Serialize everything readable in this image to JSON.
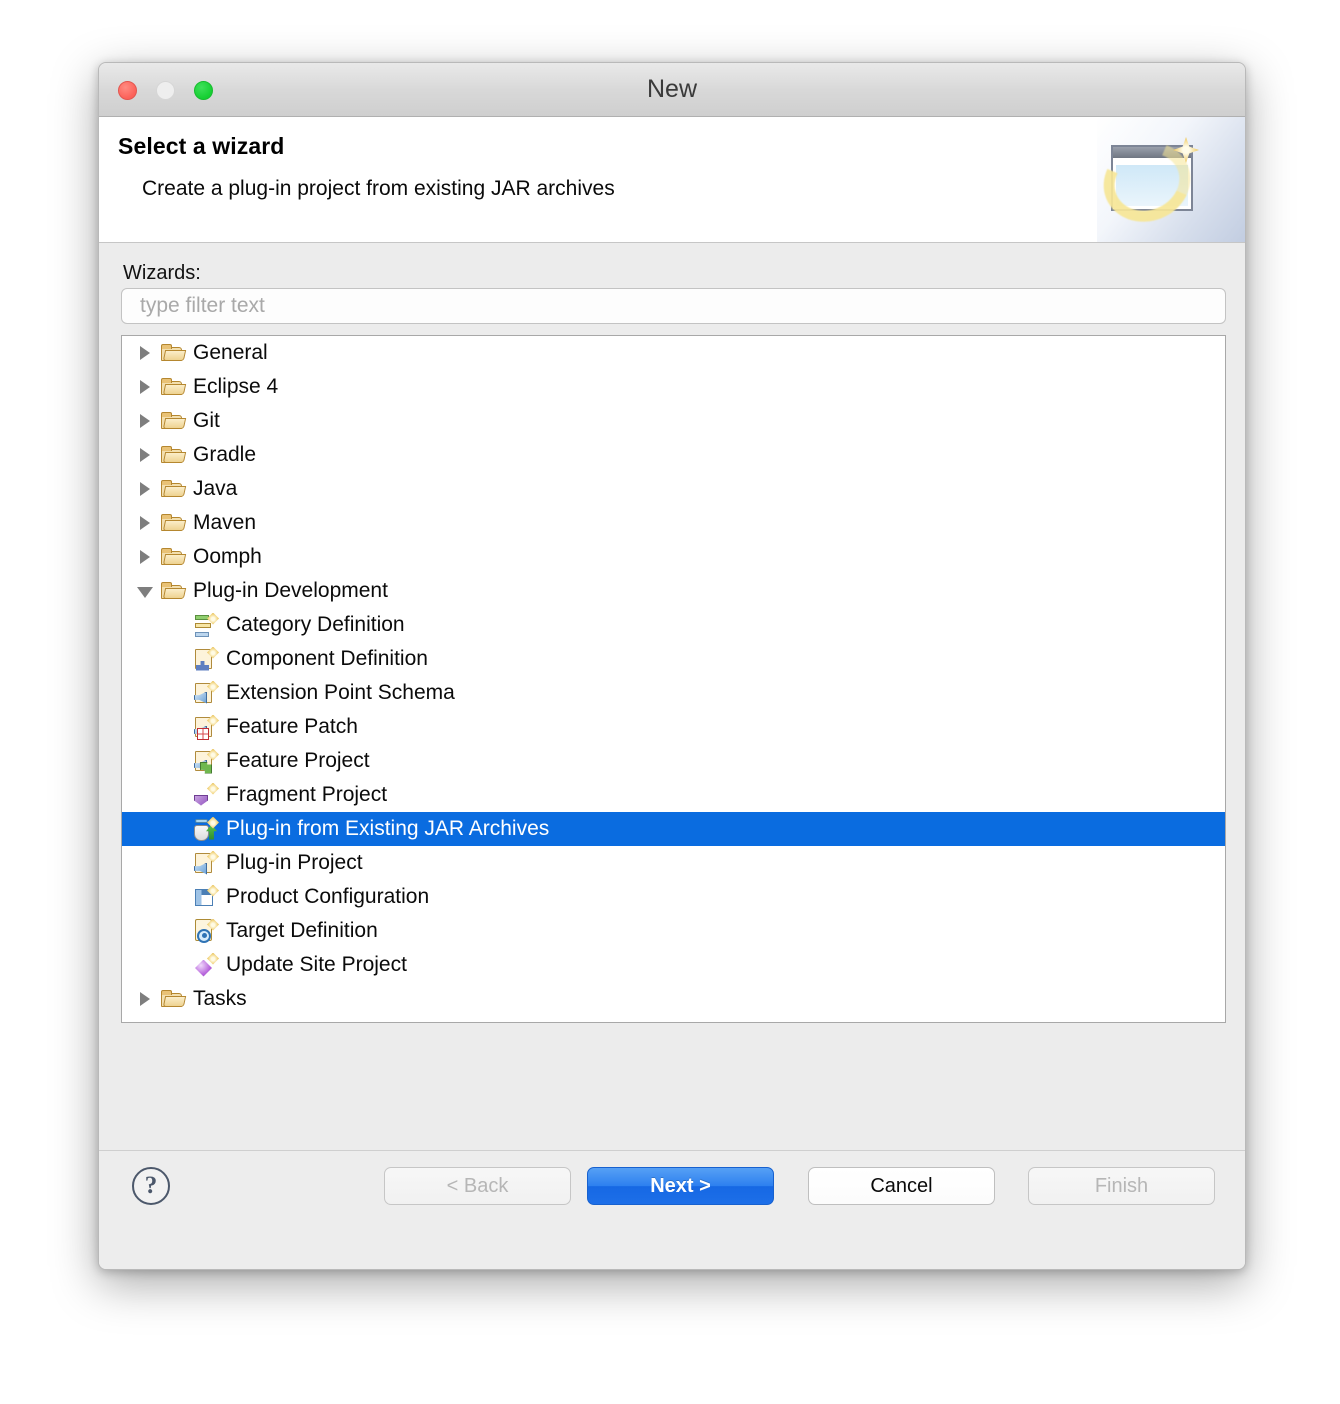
{
  "window": {
    "title": "New",
    "traffic_lights": {
      "close": "close-button",
      "minimize": "minimize-button",
      "maximize": "maximize-button"
    }
  },
  "banner": {
    "title": "Select a wizard",
    "description": "Create a plug-in project from existing JAR archives",
    "artwork": "wizard-banner-icon"
  },
  "main": {
    "wizards_label": "Wizards:",
    "filter": {
      "placeholder": "type filter text",
      "value": ""
    },
    "tree": [
      {
        "label": "General",
        "depth": 0,
        "icon": "folder-icon",
        "expanded": false,
        "selected": false
      },
      {
        "label": "Eclipse 4",
        "depth": 0,
        "icon": "folder-icon",
        "expanded": false,
        "selected": false
      },
      {
        "label": "Git",
        "depth": 0,
        "icon": "folder-icon",
        "expanded": false,
        "selected": false
      },
      {
        "label": "Gradle",
        "depth": 0,
        "icon": "folder-icon",
        "expanded": false,
        "selected": false
      },
      {
        "label": "Java",
        "depth": 0,
        "icon": "folder-icon",
        "expanded": false,
        "selected": false
      },
      {
        "label": "Maven",
        "depth": 0,
        "icon": "folder-icon",
        "expanded": false,
        "selected": false
      },
      {
        "label": "Oomph",
        "depth": 0,
        "icon": "folder-icon",
        "expanded": false,
        "selected": false
      },
      {
        "label": "Plug-in Development",
        "depth": 0,
        "icon": "folder-icon",
        "expanded": true,
        "selected": false
      },
      {
        "label": "Category Definition",
        "depth": 1,
        "icon": "category-definition-icon",
        "selected": false
      },
      {
        "label": "Component Definition",
        "depth": 1,
        "icon": "component-definition-icon",
        "selected": false
      },
      {
        "label": "Extension Point Schema",
        "depth": 1,
        "icon": "extension-point-schema-icon",
        "selected": false
      },
      {
        "label": "Feature Patch",
        "depth": 1,
        "icon": "feature-patch-icon",
        "selected": false
      },
      {
        "label": "Feature Project",
        "depth": 1,
        "icon": "feature-project-icon",
        "selected": false
      },
      {
        "label": "Fragment Project",
        "depth": 1,
        "icon": "fragment-project-icon",
        "selected": false
      },
      {
        "label": "Plug-in from Existing JAR Archives",
        "depth": 1,
        "icon": "jar-plugin-icon",
        "selected": true
      },
      {
        "label": "Plug-in Project",
        "depth": 1,
        "icon": "plugin-project-icon",
        "selected": false
      },
      {
        "label": "Product Configuration",
        "depth": 1,
        "icon": "product-configuration-icon",
        "selected": false
      },
      {
        "label": "Target Definition",
        "depth": 1,
        "icon": "target-definition-icon",
        "selected": false
      },
      {
        "label": "Update Site Project",
        "depth": 1,
        "icon": "update-site-project-icon",
        "selected": false
      },
      {
        "label": "Tasks",
        "depth": 0,
        "icon": "folder-icon",
        "expanded": false,
        "selected": false
      }
    ]
  },
  "footer": {
    "help_label": "?",
    "back_label": "< Back",
    "next_label": "Next >",
    "cancel_label": "Cancel",
    "finish_label": "Finish",
    "back_enabled": false,
    "next_enabled": true,
    "cancel_enabled": true,
    "finish_enabled": false
  },
  "colors": {
    "selection_blue": "#0a6ce0",
    "next_button_blue": "#2d80ef",
    "dialog_background": "#ececec",
    "banner_background": "#ffffff",
    "tree_background": "#ffffff",
    "disabled_text": "#b6b6b6"
  }
}
